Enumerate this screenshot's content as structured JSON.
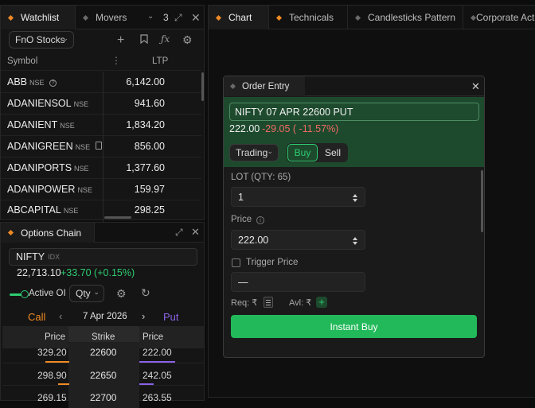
{
  "watchlist": {
    "tabs": [
      {
        "label": "Watchlist",
        "active": true
      },
      {
        "label": "Movers",
        "count": "3"
      }
    ],
    "group_select": "FnO Stocks",
    "columns": {
      "symbol": "Symbol",
      "ltp": "LTP"
    },
    "rows": [
      {
        "symbol": "ABB",
        "exchange": "NSE",
        "ltp": "6,142.00",
        "badge": "info"
      },
      {
        "symbol": "ADANIENSOL",
        "exchange": "NSE",
        "ltp": "941.60"
      },
      {
        "symbol": "ADANIENT",
        "exchange": "NSE",
        "ltp": "1,834.20"
      },
      {
        "symbol": "ADANIGREEN",
        "exchange": "NSE",
        "ltp": "856.00",
        "badge": "doc"
      },
      {
        "symbol": "ADANIPORTS",
        "exchange": "NSE",
        "ltp": "1,377.60"
      },
      {
        "symbol": "ADANIPOWER",
        "exchange": "NSE",
        "ltp": "159.97"
      },
      {
        "symbol": "ABCAPITAL",
        "exchange": "NSE",
        "ltp": "298.25"
      }
    ]
  },
  "options_chain": {
    "title": "Options Chain",
    "symbol": "NIFTY",
    "symbol_exchange": "IDX",
    "spot_price": "22,713.10",
    "spot_change": "+33.70 (+0.15%)",
    "active_oi_label": "Active OI",
    "qty_select": "Qty",
    "call_label": "Call",
    "put_label": "Put",
    "expiry": "7 Apr 2026",
    "columns": {
      "call_price": "Price",
      "strike": "Strike",
      "put_price": "Price"
    },
    "rows": [
      {
        "call": "329.20",
        "strike": "22600",
        "put": "222.00"
      },
      {
        "call": "298.90",
        "strike": "22650",
        "put": "242.05"
      },
      {
        "call": "269.15",
        "strike": "22700",
        "put": "263.55"
      }
    ]
  },
  "main_tabs": [
    {
      "label": "Chart",
      "active": true
    },
    {
      "label": "Technicals"
    },
    {
      "label": "Candlesticks Pattern"
    },
    {
      "label": "Corporate Acti"
    }
  ],
  "order_entry": {
    "title": "Order Entry",
    "instrument": "NIFTY 07 APR 22600 PUT",
    "price": "222.00",
    "change": "-29.05 ( -11.57%)",
    "order_type": "Trading",
    "buy_label": "Buy",
    "sell_label": "Sell",
    "lot_label": "LOT (QTY: 65)",
    "lot_value": "1",
    "price_label": "Price",
    "price_value": "222.00",
    "trigger_label": "Trigger Price",
    "trigger_value": "—",
    "req_label": "Req: ₹",
    "avl_label": "Avl: ₹",
    "submit_label": "Instant Buy"
  },
  "colors": {
    "accent_orange": "#f08a24",
    "buy_green": "#22b95a",
    "sell_red": "#e2524b",
    "put_purple": "#8a63e8"
  }
}
